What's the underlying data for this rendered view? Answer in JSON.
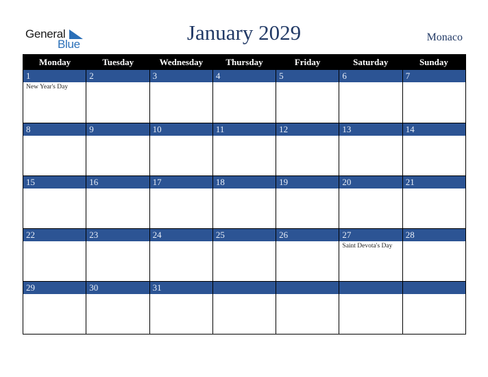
{
  "logo": {
    "text_general": "General",
    "text_blue": "Blue",
    "icon": "triangle-flag-icon",
    "brand_color": "#2a6fb8"
  },
  "title": "January 2029",
  "country": "Monaco",
  "colors": {
    "header_bg": "#000000",
    "daynum_bg": "#2c5494",
    "title_color": "#223a66"
  },
  "weekdays": [
    "Monday",
    "Tuesday",
    "Wednesday",
    "Thursday",
    "Friday",
    "Saturday",
    "Sunday"
  ],
  "weeks": [
    [
      {
        "day": "1",
        "holiday": "New Year's Day"
      },
      {
        "day": "2",
        "holiday": ""
      },
      {
        "day": "3",
        "holiday": ""
      },
      {
        "day": "4",
        "holiday": ""
      },
      {
        "day": "5",
        "holiday": ""
      },
      {
        "day": "6",
        "holiday": ""
      },
      {
        "day": "7",
        "holiday": ""
      }
    ],
    [
      {
        "day": "8",
        "holiday": ""
      },
      {
        "day": "9",
        "holiday": ""
      },
      {
        "day": "10",
        "holiday": ""
      },
      {
        "day": "11",
        "holiday": ""
      },
      {
        "day": "12",
        "holiday": ""
      },
      {
        "day": "13",
        "holiday": ""
      },
      {
        "day": "14",
        "holiday": ""
      }
    ],
    [
      {
        "day": "15",
        "holiday": ""
      },
      {
        "day": "16",
        "holiday": ""
      },
      {
        "day": "17",
        "holiday": ""
      },
      {
        "day": "18",
        "holiday": ""
      },
      {
        "day": "19",
        "holiday": ""
      },
      {
        "day": "20",
        "holiday": ""
      },
      {
        "day": "21",
        "holiday": ""
      }
    ],
    [
      {
        "day": "22",
        "holiday": ""
      },
      {
        "day": "23",
        "holiday": ""
      },
      {
        "day": "24",
        "holiday": ""
      },
      {
        "day": "25",
        "holiday": ""
      },
      {
        "day": "26",
        "holiday": ""
      },
      {
        "day": "27",
        "holiday": "Saint Devota's Day"
      },
      {
        "day": "28",
        "holiday": ""
      }
    ],
    [
      {
        "day": "29",
        "holiday": ""
      },
      {
        "day": "30",
        "holiday": ""
      },
      {
        "day": "31",
        "holiday": ""
      },
      {
        "day": "",
        "holiday": ""
      },
      {
        "day": "",
        "holiday": ""
      },
      {
        "day": "",
        "holiday": ""
      },
      {
        "day": "",
        "holiday": ""
      }
    ]
  ]
}
